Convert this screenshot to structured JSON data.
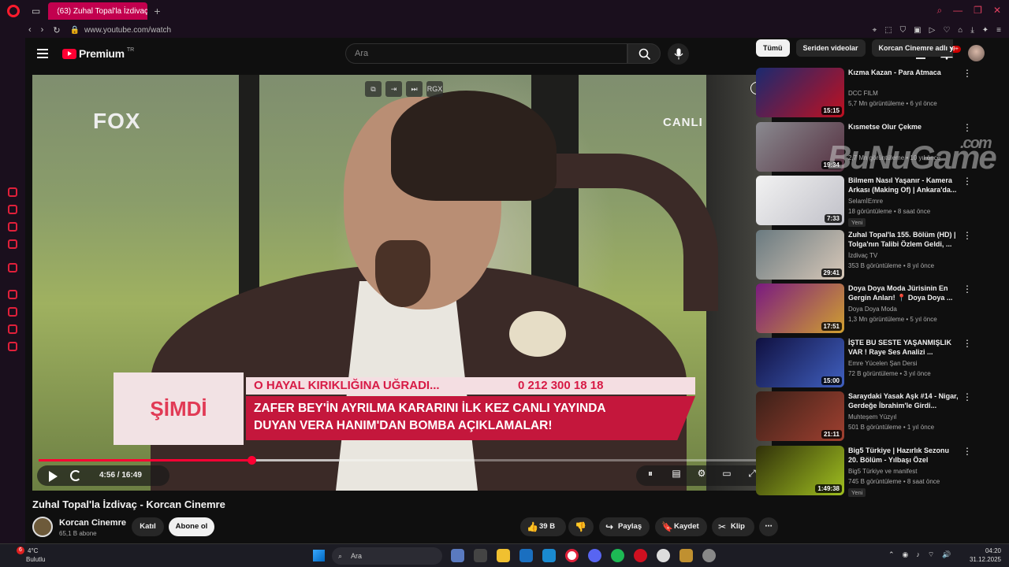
{
  "browser": {
    "tab_title": "(63) Zuhal Topal'la İzdivaç",
    "url": "www.youtube.com/watch"
  },
  "header": {
    "logo_text": "Premium",
    "logo_region": "TR",
    "search_placeholder": "Ara",
    "notification_count": "9+"
  },
  "player": {
    "overlay_channel_logo": "FOX",
    "overlay_live": "CANLI",
    "lower_third": {
      "left": "ŞİMDİ",
      "top_left": "O HAYAL KIRIKLIĞINA UĞRADI...",
      "top_right": "0 212 300 18 18",
      "line1": "ZAFER BEY'İN AYRILMA KARARINI İLK KEZ CANLI YAYINDA",
      "line2": "DUYAN VERA HANIM'DAN BOMBA AÇIKLAMALAR!"
    },
    "top_control_label": "RGX",
    "time_display": "4:56 / 16:49",
    "progress_fraction": 0.293
  },
  "video": {
    "title": "Zuhal Topal'la İzdivaç - Korcan Cinemre",
    "channel_name": "Korcan Cinemre",
    "subscribers": "65,1 B abone",
    "join_label": "Katıl",
    "subscribe_label": "Abone ol",
    "likes": "39 B",
    "share_label": "Paylaş",
    "save_label": "Kaydet",
    "clip_label": "Klip"
  },
  "chips": [
    "Tümü",
    "Seriden videolar",
    "Korcan Cinemre adlı y"
  ],
  "recommendations": [
    {
      "title": "Kızma Kazan - Para Atmaca",
      "channel": "DCC FILM",
      "meta": "5,7 Mn görüntüleme • 6 yıl önce",
      "duration": "15:15",
      "colors": [
        "#1a2a70",
        "#c01020"
      ]
    },
    {
      "title": "Kısmetse Olur Çekme",
      "channel": "",
      "meta": "2,7 Mn görüntüleme • 10 yıl önce",
      "duration": "19:34",
      "colors": [
        "#8a8a90",
        "#553040"
      ]
    },
    {
      "title": "Bilmem Nasıl Yaşanır - Kamera Arkası (Making Of) | Ankara'da...",
      "channel": "SelamİEmre",
      "meta": "18 görüntüleme • 8 saat önce",
      "duration": "7:33",
      "badge": "Yeni",
      "colors": [
        "#f2f2f2",
        "#c0c0c8"
      ]
    },
    {
      "title": "Zuhal Topal'la 155. Bölüm (HD) | Tolga'nın Talibi Özlem Geldi, ...",
      "channel": "İzdivaç TV",
      "meta": "353 B görüntüleme • 8 yıl önce",
      "duration": "29:41",
      "colors": [
        "#6a7a80",
        "#d8c8b8"
      ]
    },
    {
      "title": "Doya Doya Moda Jürisinin En Gergin Anları! 📍 Doya Doya ...",
      "channel": "Doya Doya Moda",
      "meta": "1,3 Mn görüntüleme • 5 yıl önce",
      "duration": "17:51",
      "colors": [
        "#7a1a80",
        "#d0a030"
      ]
    },
    {
      "title": "İŞTE BU SESTE YAŞANMIŞLIK VAR ! Raye Ses Analizi ...",
      "channel": "Emre Yücelen Şan Dersi",
      "meta": "72 B görüntüleme • 3 yıl önce",
      "duration": "15:00",
      "colors": [
        "#101040",
        "#4060c0"
      ]
    },
    {
      "title": "Saraydaki Yasak Aşk #14 - Nigar, Gerdeğe İbrahim'le Girdi...",
      "channel": "Muhteşem Yüzyıl",
      "meta": "501 B görüntüleme • 1 yıl önce",
      "duration": "21:11",
      "colors": [
        "#3a2018",
        "#a04030"
      ]
    },
    {
      "title": "Big5 Türkiye | Hazırlık Sezonu 20. Bölüm - Yılbaşı Özel",
      "channel": "Big5 Türkiye ve manifest",
      "meta": "745 B görüntüleme • 8 saat önce",
      "duration": "1:49:38",
      "badge": "Yeni",
      "colors": [
        "#30300a",
        "#a0c020"
      ]
    }
  ],
  "watermark": {
    "main": "BuNuGame",
    "suffix": ".com"
  },
  "taskbar": {
    "weather_badge": "6",
    "temperature": "4°C",
    "condition": "Bulutlu",
    "search_label": "Ara",
    "time": "04:20",
    "date": "31.12.2025"
  }
}
